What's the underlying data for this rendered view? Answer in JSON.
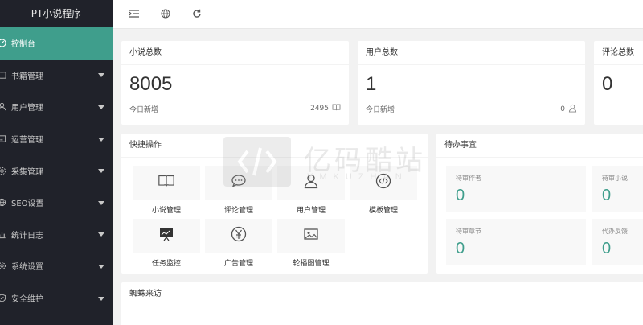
{
  "app": {
    "title": "PT小说程序"
  },
  "colors": {
    "accent": "#3f9e8c",
    "sidebar_bg": "#20222a"
  },
  "sidebar": {
    "items": [
      {
        "label": "控制台",
        "icon": "dashboard-icon",
        "active": true,
        "has_submenu": false
      },
      {
        "label": "书籍管理",
        "icon": "book-icon",
        "active": false,
        "has_submenu": true
      },
      {
        "label": "用户管理",
        "icon": "user-icon",
        "active": false,
        "has_submenu": true
      },
      {
        "label": "运营管理",
        "icon": "operation-icon",
        "active": false,
        "has_submenu": true
      },
      {
        "label": "采集管理",
        "icon": "gear-icon",
        "active": false,
        "has_submenu": true
      },
      {
        "label": "SEO设置",
        "icon": "globe-icon",
        "active": false,
        "has_submenu": true
      },
      {
        "label": "统计日志",
        "icon": "chart-icon",
        "active": false,
        "has_submenu": true
      },
      {
        "label": "系统设置",
        "icon": "settings-icon",
        "active": false,
        "has_submenu": true
      },
      {
        "label": "安全维护",
        "icon": "shield-icon",
        "active": false,
        "has_submenu": true
      }
    ]
  },
  "toolbar": {
    "icons": [
      "menu-toggle-icon",
      "globe-icon",
      "refresh-icon"
    ]
  },
  "stats": {
    "novels": {
      "title": "小说总数",
      "value": "8005",
      "sub_label": "今日新增",
      "today": "2495"
    },
    "users": {
      "title": "用户总数",
      "value": "1",
      "sub_label": "今日新增",
      "today": "0"
    },
    "comments": {
      "title": "评论总数",
      "value": "0"
    }
  },
  "quick": {
    "title": "快捷操作",
    "items": [
      {
        "label": "小说管理",
        "icon": "book-icon"
      },
      {
        "label": "评论管理",
        "icon": "comment-icon"
      },
      {
        "label": "用户管理",
        "icon": "user-icon"
      },
      {
        "label": "模板管理",
        "icon": "code-icon"
      },
      {
        "label": "任务监控",
        "icon": "monitor-icon"
      },
      {
        "label": "广告管理",
        "icon": "yen-icon"
      },
      {
        "label": "轮播图管理",
        "icon": "image-icon"
      }
    ]
  },
  "todo": {
    "title": "待办事宜",
    "items": [
      {
        "label": "待审作者",
        "value": "0"
      },
      {
        "label": "待审小说",
        "value": "0"
      },
      {
        "label": "待审章节",
        "value": "0"
      },
      {
        "label": "代办反馈",
        "value": "0"
      }
    ]
  },
  "spider": {
    "title": "蜘蛛来访"
  },
  "watermark": {
    "title": "亿码酷站",
    "sub": "YMKUZHAN"
  }
}
